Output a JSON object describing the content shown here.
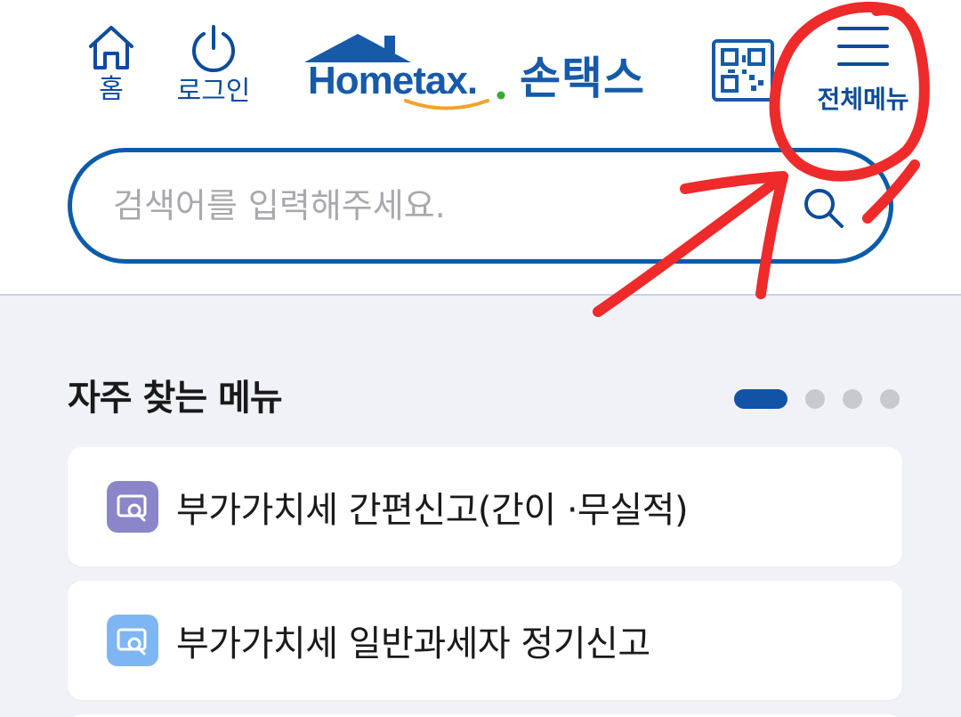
{
  "header": {
    "home_label": "홈",
    "login_label": "로그인",
    "logo_wordmark": "Hometax.",
    "logo_korean": "손택스",
    "full_menu_label": "전체메뉴"
  },
  "search": {
    "placeholder": "검색어를 입력해주세요.",
    "value": ""
  },
  "frequent_menu": {
    "title": "자주 찾는 메뉴",
    "page_count": 4,
    "active_page": 1,
    "items": [
      {
        "label": "부가가치세 간편신고(간이 ·무실적)",
        "icon": "search-document-icon",
        "icon_color": "#8a86c9"
      },
      {
        "label": "부가가치세 일반과세자 정기신고",
        "icon": "search-document-icon",
        "icon_color": "#7eb6f4"
      }
    ]
  },
  "colors": {
    "brand_blue": "#0d5ba8",
    "accent_orange": "#f0a32b",
    "indicator_active": "#1253a6",
    "annotation_red": "#ee2a2a"
  },
  "annotation": {
    "description_icon": "red-circle-and-arrow-markup",
    "target": "full-menu-button"
  }
}
